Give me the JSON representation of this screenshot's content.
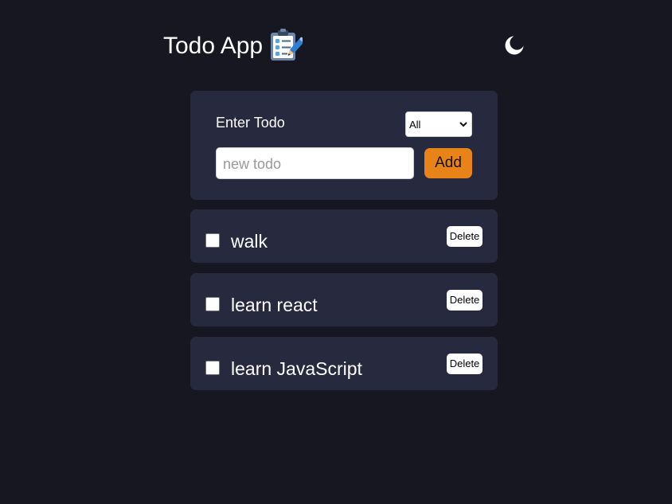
{
  "header": {
    "title": "Todo App",
    "icon": "clipboard-icon",
    "theme_toggle_icon": "moon-icon"
  },
  "form": {
    "label": "Enter Todo",
    "filter": {
      "selected": "All"
    },
    "input": {
      "value": "",
      "placeholder": "new todo"
    },
    "add_label": "Add"
  },
  "todos": [
    {
      "text": "walk",
      "checked": false,
      "delete_label": "Delete"
    },
    {
      "text": "learn react",
      "checked": false,
      "delete_label": "Delete"
    },
    {
      "text": "learn JavaScript",
      "checked": false,
      "delete_label": "Delete"
    }
  ],
  "colors": {
    "background": "#161721",
    "card": "#272a3f",
    "accent": "#e88318",
    "text": "#ffffff"
  }
}
